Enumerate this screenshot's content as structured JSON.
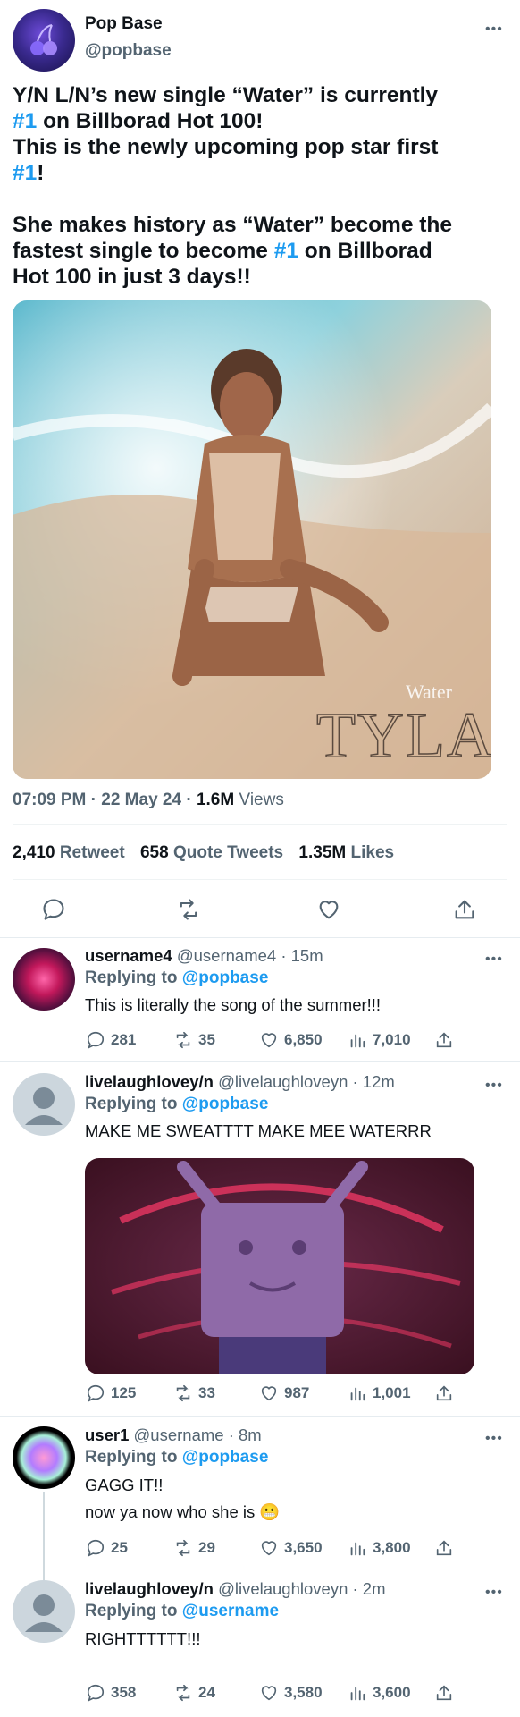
{
  "main_tweet": {
    "name": "Pop Base",
    "handle": "@popbase",
    "text": {
      "l1_a": "Y/N L/N’s new single “Water” is currently",
      "l2_hash": "#1",
      "l2_rest": " on Billborad Hot 100!",
      "l3": "This is the newly upcoming pop star first",
      "l4_hash": "#1",
      "l4_rest": "!",
      "l5": "She makes history as “Water” become the",
      "l6_a": "fastest single to become ",
      "l6_hash": "#1",
      "l6_b": " on Billborad",
      "l7": "Hot 100 in just 3 days!!"
    },
    "media": {
      "overlay_small": "Water",
      "overlay_big": "TYLA"
    },
    "time": "07:09 PM",
    "date": "22 May 24",
    "views_count": "1.6M",
    "views_label": "Views",
    "retweets_count": "2,410",
    "retweets_label": "Retweet",
    "quotes_count": "658",
    "quotes_label": "Quote Tweets",
    "likes_count": "1.35M",
    "likes_label": "Likes",
    "more_glyph": "•••"
  },
  "replies": [
    {
      "name": "username4",
      "handle": "@username4 · 15m",
      "replying_prefix": "Replying to",
      "replying_to": "@popbase",
      "text_lines": [
        "This is literally the song of the summer!!!"
      ],
      "replies": "281",
      "retweets": "35",
      "likes": "6,850",
      "views": "7,010"
    },
    {
      "name": "livelaughlovey/n",
      "handle": "@livelaughloveyn · 12m",
      "replying_prefix": "Replying to",
      "replying_to": "@popbase",
      "text_lines": [
        "MAKE ME SWEATTTT MAKE MEE WATERRR"
      ],
      "replies": "125",
      "retweets": "33",
      "likes": "987",
      "views": "1,001"
    },
    {
      "name": "user1",
      "handle": "@username · 8m",
      "replying_prefix": "Replying to",
      "replying_to": "@popbase",
      "text_lines": [
        "GAGG IT!!",
        "now ya now who she is 😬"
      ],
      "replies": "25",
      "retweets": "29",
      "likes": "3,650",
      "views": "3,800"
    },
    {
      "name": "livelaughlovey/n",
      "handle": "@livelaughloveyn · 2m",
      "replying_prefix": "Replying to",
      "replying_to": "@username",
      "text_lines": [
        "RIGHTTTTTT!!!"
      ],
      "replies": "358",
      "retweets": "24",
      "likes": "3,580",
      "views": "3,600"
    }
  ],
  "colors": {
    "accent": "#1d9bf0",
    "muted": "#536471",
    "text": "#0f1419",
    "divider": "#eff3f4"
  },
  "icons": [
    "reply-icon",
    "retweet-icon",
    "like-icon",
    "views-icon",
    "share-icon",
    "more-icon",
    "default-avatar-icon"
  ]
}
